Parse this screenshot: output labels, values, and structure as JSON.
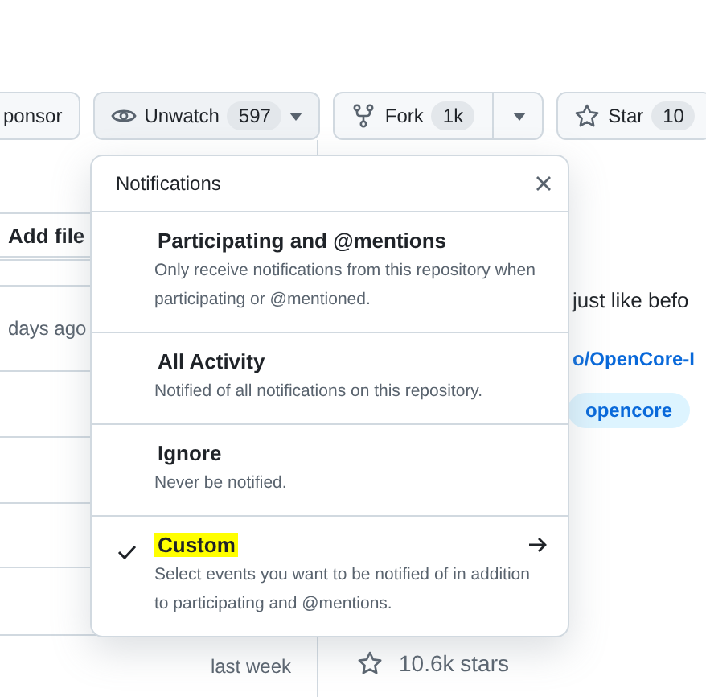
{
  "repo_actions": [
    {
      "kind": "plain",
      "label": "ponsor"
    },
    {
      "kind": "watch",
      "label": "Unwatch",
      "count": "597"
    },
    {
      "kind": "fork",
      "label": "Fork",
      "count": "1k"
    },
    {
      "kind": "star",
      "label": "Star",
      "count": "10"
    }
  ],
  "files": {
    "add_file": "Add file",
    "times": [
      "days ago",
      "last week"
    ]
  },
  "about": {
    "description": "just like befo",
    "link": "o/OpenCore-I",
    "topics": [
      "opencore"
    ],
    "stars": "10.6k stars"
  },
  "notifications": {
    "title": "Notifications",
    "options": [
      {
        "title": "Participating and @mentions",
        "description": "Only receive notifications from this repository when participating or @mentioned.",
        "selected": false,
        "highlighted": false,
        "submenu": false
      },
      {
        "title": "All Activity",
        "description": "Notified of all notifications on this repository.",
        "selected": false,
        "highlighted": false,
        "submenu": false
      },
      {
        "title": "Ignore",
        "description": "Never be notified.",
        "selected": false,
        "highlighted": false,
        "submenu": false
      },
      {
        "title": "Custom",
        "description": "Select events you want to be notified of in addition to participating and @mentions.",
        "selected": true,
        "highlighted": true,
        "submenu": true
      }
    ]
  }
}
